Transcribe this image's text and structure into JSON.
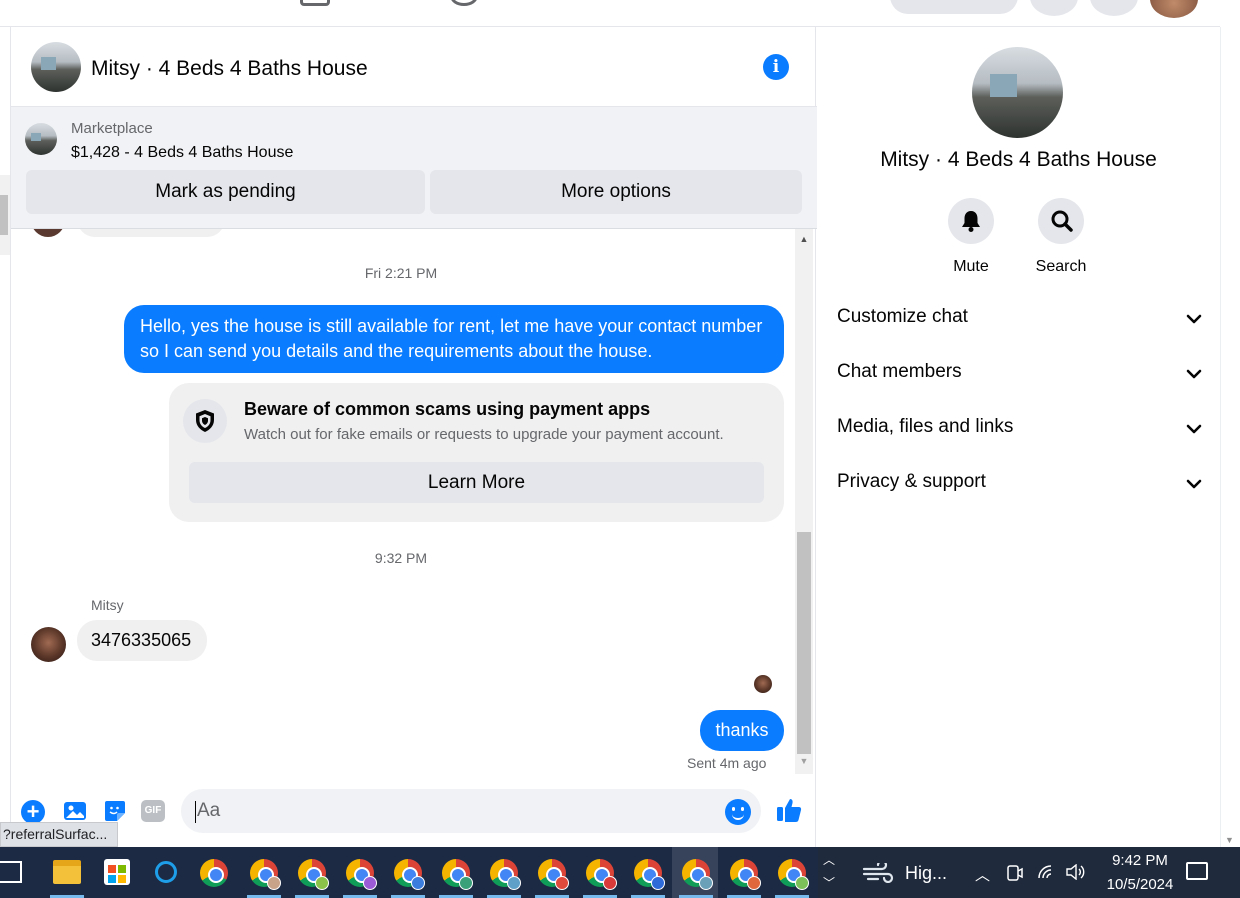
{
  "chat": {
    "title": "Mitsy · 4 Beds 4 Baths House",
    "marketplace": {
      "label": "Marketplace",
      "listing": "$1,428 - 4 Beds 4 Baths House",
      "mark_pending": "Mark as pending",
      "more_options": "More options"
    },
    "messages": {
      "ts1": "Fri 2:21 PM",
      "outgoing1": "Hello, yes the house is still available for rent, let me have your contact number so I can send you details and the requirements about the house.",
      "scam_title": "Beware of common scams using payment apps",
      "scam_sub": "Watch out for fake emails or requests to upgrade your payment account.",
      "learn_more": "Learn More",
      "ts2": "9:32 PM",
      "sender": "Mitsy",
      "incoming1": "3476335065",
      "outgoing2": "thanks",
      "sent_status": "Sent 4m ago"
    },
    "composer": {
      "placeholder": "Aa",
      "gif_label": "GIF"
    }
  },
  "url_tooltip": "?referralSurfac...",
  "details": {
    "name": "Mitsy · 4 Beds 4 Baths House",
    "mute": "Mute",
    "search": "Search",
    "sections": [
      "Customize chat",
      "Chat members",
      "Media, files and links",
      "Privacy & support"
    ]
  },
  "taskbar": {
    "weather": "Hig...",
    "time": "9:42 PM",
    "date": "10/5/2024"
  },
  "colors": {
    "messenger_blue": "#0a7cff",
    "bubble_grey": "#f0f0f0",
    "taskbar": "#1f2a3c"
  }
}
